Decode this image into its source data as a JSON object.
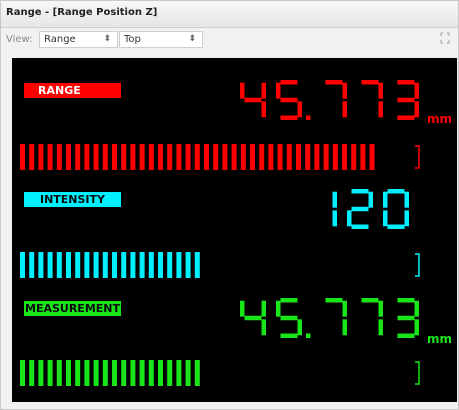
{
  "window": {
    "title": "Range - [Range Position Z]",
    "corner_icon": "maximize-icon"
  },
  "toolbar": {
    "view_label": "View:",
    "view_select": "Range",
    "position_select": "Top"
  },
  "readouts": [
    {
      "label": "RANGE",
      "value": "45.773",
      "unit": "mm",
      "bar_fraction": 0.93,
      "color": "#ff0000"
    },
    {
      "label": "INTENSITY",
      "value": "120",
      "unit": "",
      "bar_fraction": 0.47,
      "color": "#00f0ff"
    },
    {
      "label": "MEASUREMENT",
      "value": "45.773",
      "unit": "mm",
      "bar_fraction": 0.47,
      "color": "#19e619"
    }
  ]
}
